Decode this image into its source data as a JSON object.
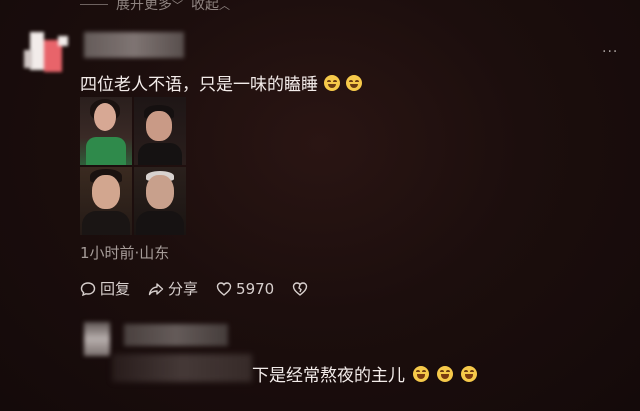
{
  "top_bar": {
    "expand_label": "展开更多",
    "collapse_label": "收起"
  },
  "comment": {
    "text": "四位老人不语，只是一味的瞌睡",
    "emoji": [
      "smiling-emoji",
      "smiling-emoji"
    ],
    "meta": "1小时前·山东",
    "actions": {
      "reply_label": "回复",
      "share_label": "分享",
      "like_count": "5970"
    },
    "image_grid": [
      "woman-in-green-dress",
      "man-dark-hair",
      "man-in-suit",
      "older-man-grey-hair"
    ]
  },
  "reply": {
    "text": "下是经常熬夜的主儿",
    "emoji": [
      "laughing-emoji",
      "laughing-emoji",
      "laughing-emoji"
    ]
  },
  "colors": {
    "background": "#1c0e0d",
    "text": "#f3ecea",
    "secondary": "#a69c99"
  }
}
